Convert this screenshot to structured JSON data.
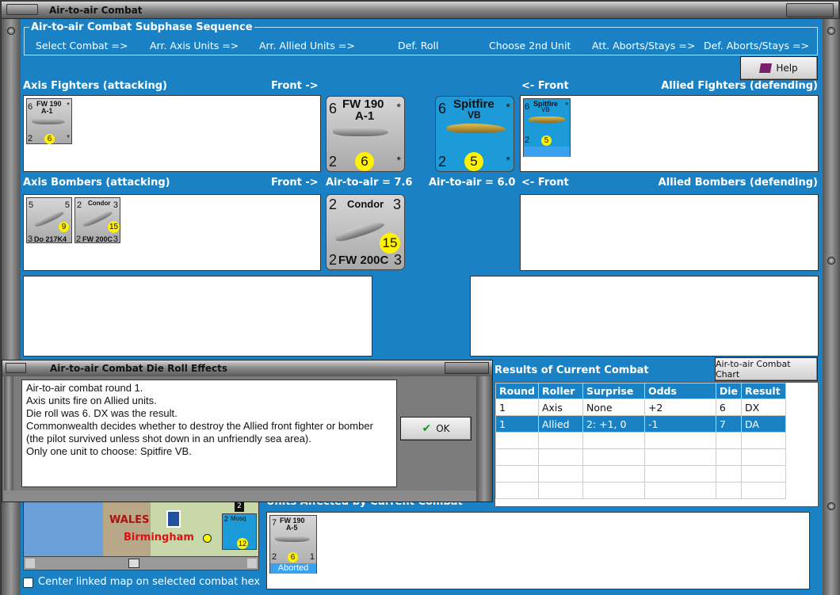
{
  "window": {
    "title": "Air-to-air Combat"
  },
  "sequence": {
    "title": "Air-to-air Combat Subphase Sequence",
    "steps": [
      "Select Combat =>",
      "Arr. Axis Units =>",
      "Arr. Allied Units =>",
      "Def. Roll",
      "Choose 2nd Unit",
      "Att. Aborts/Stays =>",
      "Def. Aborts/Stays =>"
    ]
  },
  "help_label": "Help",
  "axis_fighters": {
    "label": "Axis Fighters (attacking)",
    "front": "Front ->"
  },
  "allied_fighters": {
    "label": "Allied Fighters (defending)",
    "front": "<- Front"
  },
  "axis_bombers": {
    "label": "Axis Bombers (attacking)",
    "front": "Front ->"
  },
  "allied_bombers": {
    "label": "Allied Bombers (defending)",
    "front": "<- Front"
  },
  "axis_air_to_air": "Air-to-air = 7.6",
  "allied_air_to_air": "Air-to-air = 6.0",
  "units": {
    "fw190": {
      "name": "FW 190",
      "sub": "A-1",
      "tl": "6",
      "bl": "2",
      "circle": "6",
      "tr": "*",
      "br": "*"
    },
    "spitfire": {
      "name": "Spitfire",
      "sub": "VB",
      "tl": "6",
      "bl": "2",
      "circle": "5",
      "tr": "*",
      "br": "*"
    },
    "do217": {
      "name": "Do 217K4",
      "tl": "5",
      "tr": "5",
      "bl": "3",
      "circle": "9"
    },
    "condor": {
      "name": "Condor",
      "bottom": "FW 200C",
      "tl": "2",
      "tr": "3",
      "bl": "2",
      "br": "3",
      "circle": "15"
    },
    "fw190a5": {
      "name": "FW 190",
      "sub": "A-5",
      "tl": "7",
      "bl": "2",
      "circle": "6",
      "br": "1",
      "status": "Aborted"
    }
  },
  "dialog": {
    "title": "Air-to-air Combat Die Roll Effects",
    "lines": [
      "Air-to-air combat round 1.",
      "Axis units fire on Allied units.",
      "Die roll was 6.  DX was the result.",
      "Commonwealth decides whether to destroy the Allied front fighter or bomber (the pilot survived unless shot down in an unfriendly sea area).",
      "Only one unit to choose: Spitfire VB."
    ],
    "ok_label": "OK"
  },
  "results": {
    "title": "Results of Current Combat",
    "chart_button": "Air-to-air Combat Chart",
    "columns": [
      "Round",
      "Roller",
      "Surprise",
      "Odds",
      "Die",
      "Result"
    ],
    "rows": [
      [
        "1",
        "Axis",
        "None",
        "+2",
        "6",
        "DX"
      ],
      [
        "1",
        "Allied",
        "2: +1, 0",
        "-1",
        "7",
        "DA"
      ]
    ]
  },
  "units_affected": {
    "label": "Units Affected by Current Combat"
  },
  "map": {
    "wales": "WALES",
    "birmingham": "Birmingham",
    "hex_num": "2",
    "hex_circle": "12",
    "hex_tl": "2",
    "hex_name": "Mosq"
  },
  "center_map_label": "Center linked map on selected combat hex",
  "colors": {
    "panel_blue": "#1a82c4",
    "selection_blue": "#1a82c4",
    "attack_circle": "#fff200"
  }
}
